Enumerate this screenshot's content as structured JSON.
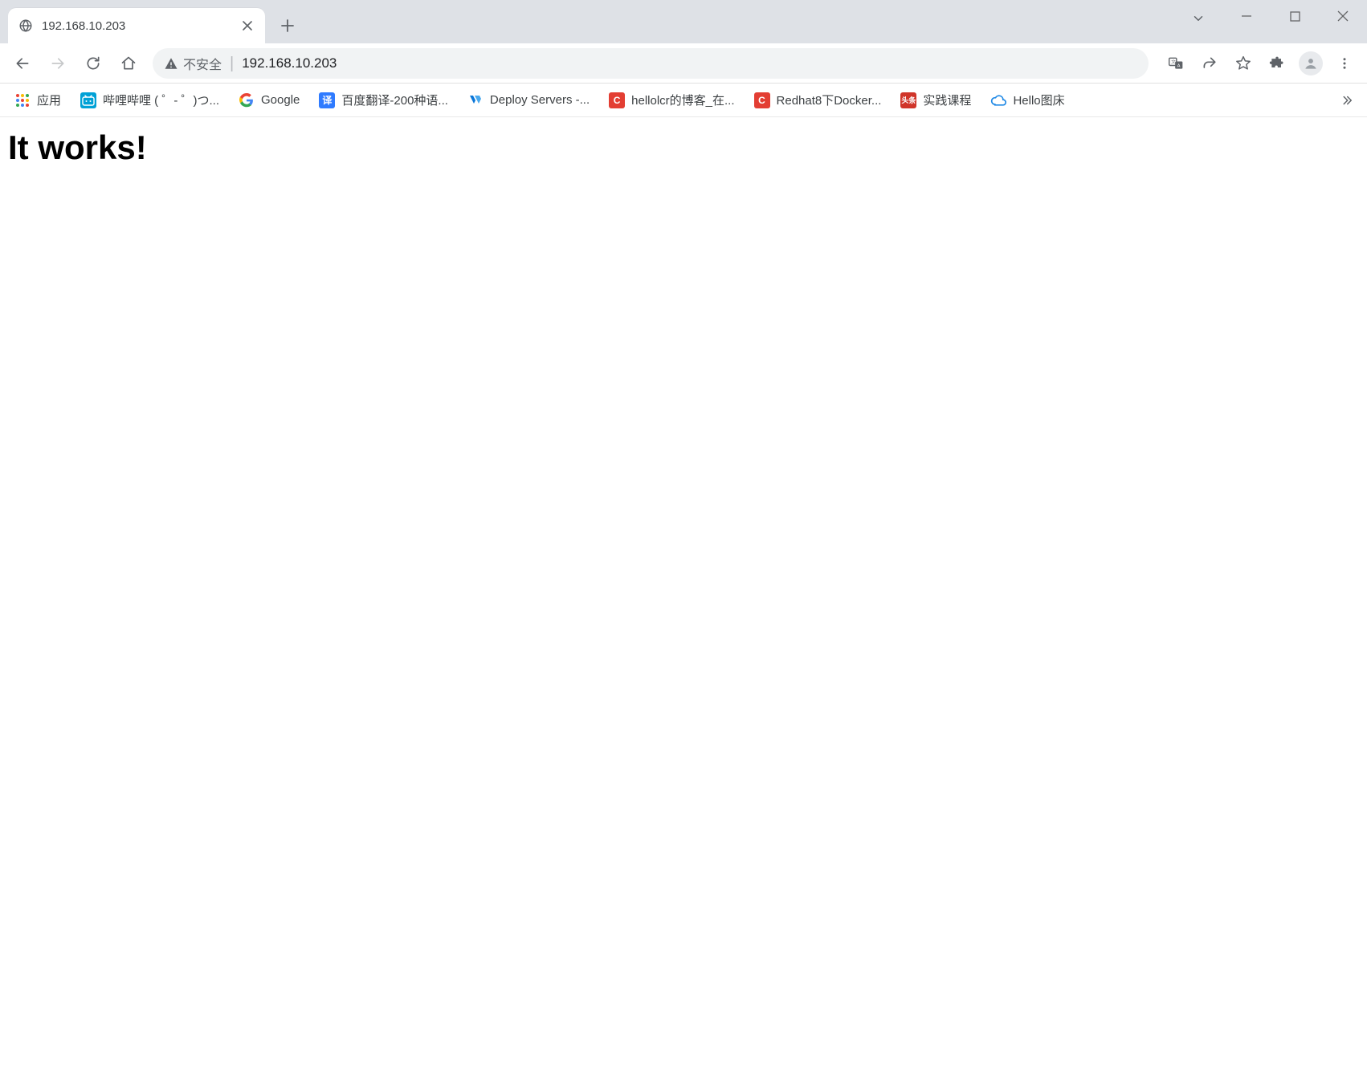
{
  "tab": {
    "title": "192.168.10.203"
  },
  "omnibox": {
    "security_label": "不安全",
    "address": "192.168.10.203"
  },
  "bookmarks": {
    "apps_label": "应用",
    "items": [
      {
        "label": "哔哩哔哩 ( ゜- ゜)つ..."
      },
      {
        "label": "Google"
      },
      {
        "label": "百度翻译-200种语..."
      },
      {
        "label": "Deploy Servers -..."
      },
      {
        "label": "hellolcr的博客_在..."
      },
      {
        "label": "Redhat8下Docker..."
      },
      {
        "label": "实践课程"
      },
      {
        "label": "Hello图床"
      }
    ]
  },
  "page": {
    "heading": "It works!"
  }
}
